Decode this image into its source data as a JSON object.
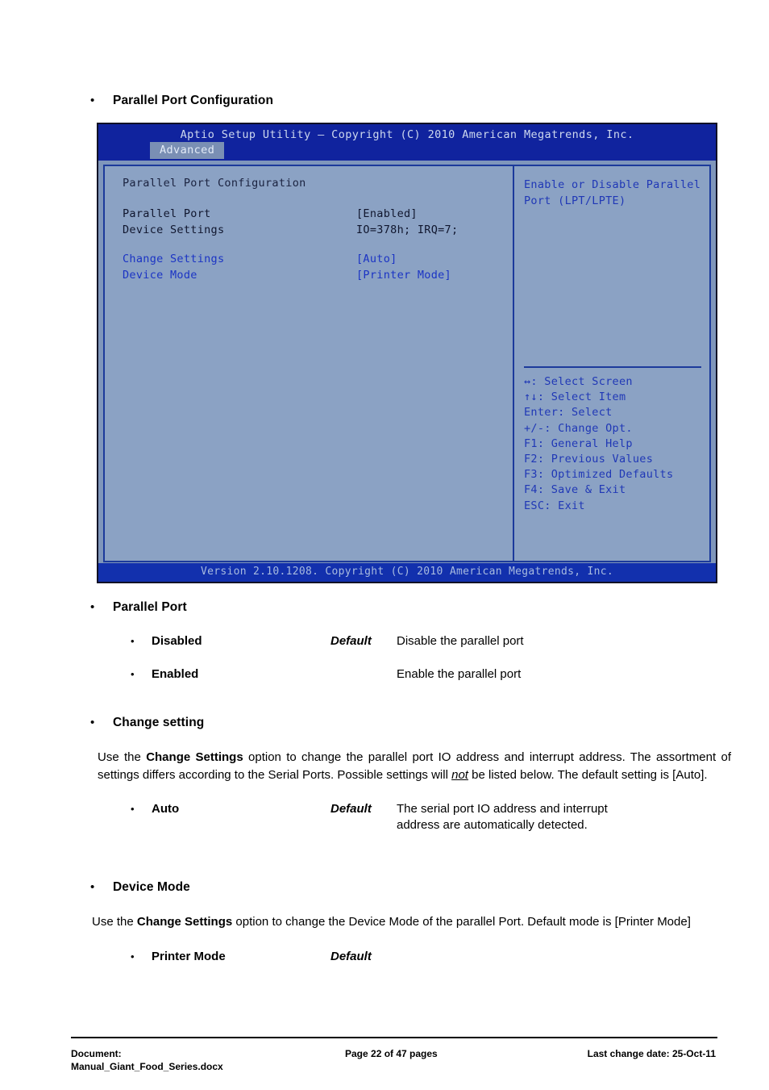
{
  "document": {
    "top_heading": "Parallel Port  Configuration"
  },
  "bios": {
    "title": "Aptio Setup Utility – Copyright (C) 2010 American Megatrends, Inc.",
    "tab": "Advanced",
    "section_title": "Parallel Port Configuration",
    "settings": [
      {
        "label": "Parallel Port",
        "value": "[Enabled]"
      },
      {
        "label": "Device Settings",
        "value": "IO=378h; IRQ=7;"
      },
      {
        "label": "Change Settings",
        "value": "[Auto]"
      },
      {
        "label": "Device Mode",
        "value": "[Printer Mode]"
      }
    ],
    "help_line1": "Enable or Disable Parallel",
    "help_line2": "Port (LPT/LPTE)",
    "keys": [
      "↔: Select Screen",
      "↑↓: Select Item",
      "Enter: Select",
      "+/-: Change Opt.",
      "F1: General Help",
      "F2: Previous Values",
      "F3: Optimized Defaults",
      "F4: Save & Exit",
      "ESC: Exit"
    ],
    "version_footer": "Version 2.10.1208. Copyright (C) 2010 American Megatrends, Inc."
  },
  "sections": {
    "parallel_port": {
      "heading": "Parallel Port",
      "options": [
        {
          "label": "Disabled",
          "default": "Default",
          "desc": "Disable the parallel port"
        },
        {
          "label": "Enabled",
          "default": "",
          "desc": "Enable the parallel port"
        }
      ]
    },
    "change_setting": {
      "heading": "Change setting",
      "para_a": "Use the ",
      "para_b": "Change Settings",
      "para_c": " option to change the parallel port IO address and interrupt address. The assortment of settings differs according to the Serial Ports. Possible settings will ",
      "para_d": "not",
      "para_e": " be listed below. The default setting is [Auto].",
      "options": [
        {
          "label": "Auto",
          "default": "Default",
          "desc_line1": "The serial port IO address and interrupt",
          "desc_line2": "address are automatically detected."
        }
      ]
    },
    "device_mode": {
      "heading": "Device Mode",
      "para_a": "Use the ",
      "para_b": "Change Settings",
      "para_c": " option to change the Device Mode of the parallel Port. Default mode is [Printer Mode]",
      "options": [
        {
          "label": "Printer Mode",
          "default": "Default",
          "desc": ""
        }
      ]
    }
  },
  "footer": {
    "doc_label": "Document:",
    "doc_name": "Manual_Giant_Food_Series.docx",
    "page": "Page 22 of 47 pages",
    "last_change": "Last change date: 25-Oct-11"
  },
  "colors": {
    "bios_titlebar": "#10239e",
    "bios_panel": "#8ba2c4",
    "bios_link": "#1b34c4",
    "bios_border": "#1c3a9b"
  }
}
